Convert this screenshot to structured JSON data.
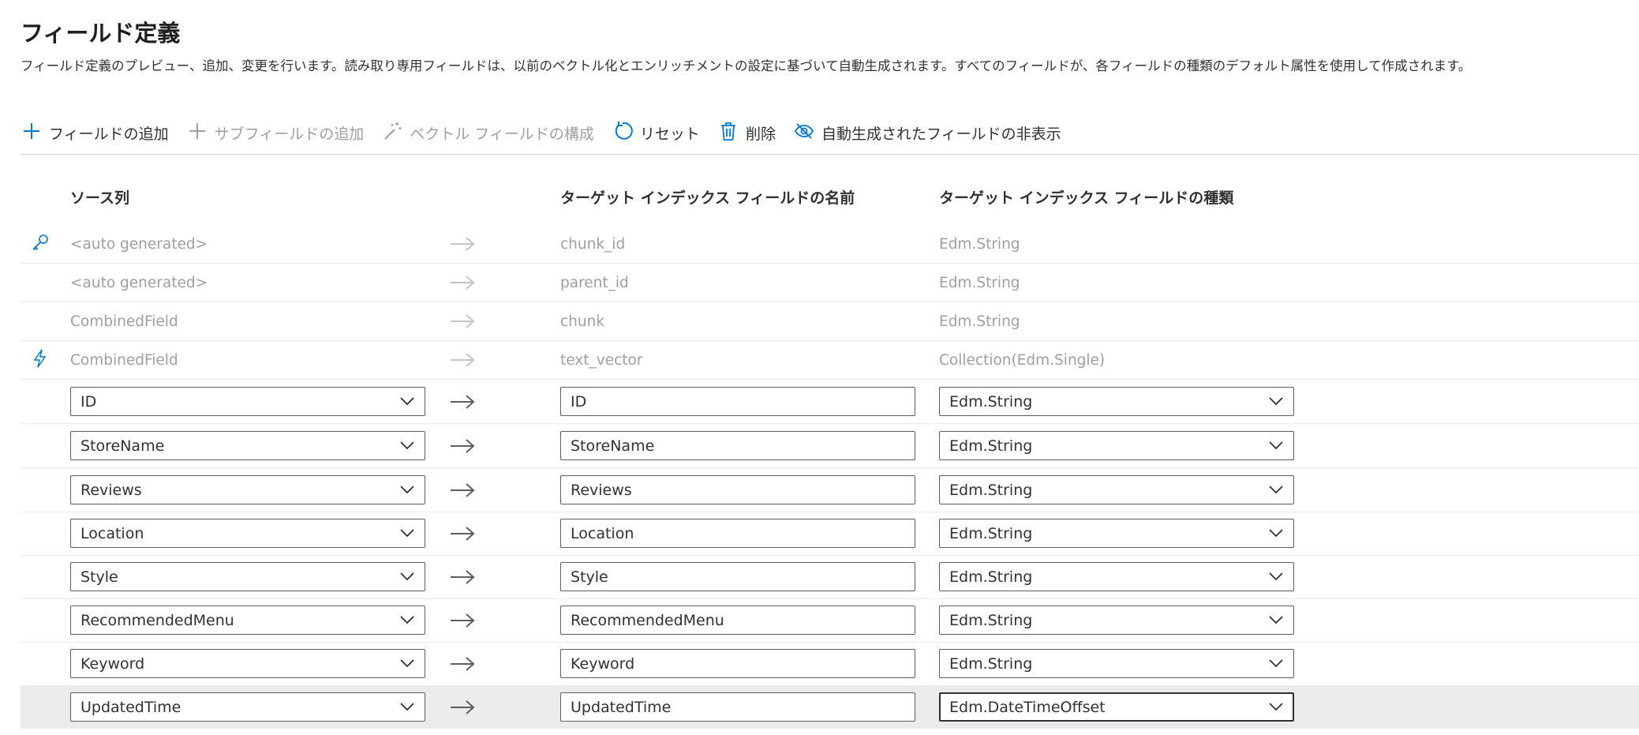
{
  "page": {
    "title": "フィールド定義",
    "description": "フィールド定義のプレビュー、追加、変更を行います。読み取り専用フィールドは、以前のベクトル化とエンリッチメントの設定に基づいて自動生成されます。すべてのフィールドが、各フィールドの種類のデフォルト属性を使用して作成されます。"
  },
  "toolbar": {
    "add_field": "フィールドの追加",
    "add_subfield": "サブフィールドの追加",
    "configure_vector": "ベクトル フィールドの構成",
    "reset": "リセット",
    "delete": "削除",
    "hide_autogen": "自動生成されたフィールドの非表示"
  },
  "table": {
    "headers": {
      "source": "ソース列",
      "target_name": "ターゲット インデックス フィールドの名前",
      "target_type": "ターゲット インデックス フィールドの種類"
    },
    "readonly_rows": [
      {
        "icon": "key-icon",
        "source": "<auto generated>",
        "name": "chunk_id",
        "type": "Edm.String"
      },
      {
        "icon": "",
        "source": "<auto generated>",
        "name": "parent_id",
        "type": "Edm.String"
      },
      {
        "icon": "",
        "source": "CombinedField",
        "name": "chunk",
        "type": "Edm.String"
      },
      {
        "icon": "lightning-icon",
        "source": "CombinedField",
        "name": "text_vector",
        "type": "Collection(Edm.Single)"
      }
    ],
    "editable_rows": [
      {
        "source": "ID",
        "name": "ID",
        "type": "Edm.String"
      },
      {
        "source": "StoreName",
        "name": "StoreName",
        "type": "Edm.String"
      },
      {
        "source": "Reviews",
        "name": "Reviews",
        "type": "Edm.String"
      },
      {
        "source": "Location",
        "name": "Location",
        "type": "Edm.String"
      },
      {
        "source": "Style",
        "name": "Style",
        "type": "Edm.String"
      },
      {
        "source": "RecommendedMenu",
        "name": "RecommendedMenu",
        "type": "Edm.String"
      },
      {
        "source": "Keyword",
        "name": "Keyword",
        "type": "Edm.String"
      },
      {
        "source": "UpdatedTime",
        "name": "UpdatedTime",
        "type": "Edm.DateTimeOffset"
      }
    ]
  },
  "colors": {
    "accent": "#0078d4",
    "disabled_text": "#a19f9d",
    "selected_row": "#ebebeb"
  }
}
